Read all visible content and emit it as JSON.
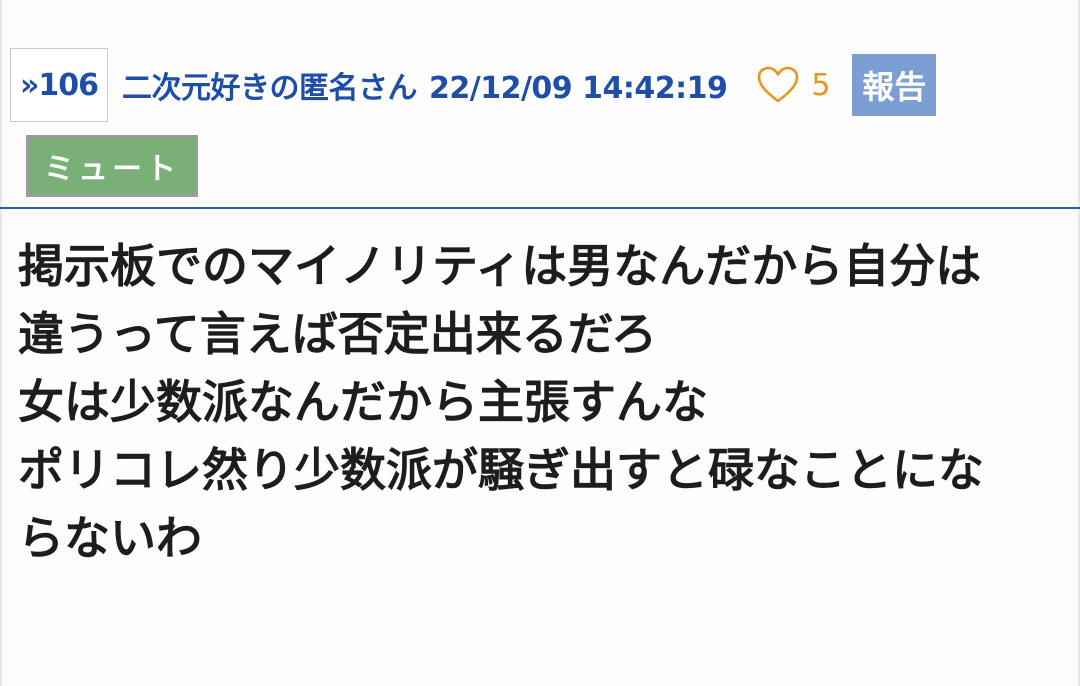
{
  "post": {
    "anchor_label": "»106",
    "author": "二次元好きの匿名さん",
    "datetime": "22/12/09 14:42:19",
    "likes": "5",
    "report_label": "報告",
    "mute_label": "ミュート",
    "body_lines": [
      "掲示板でのマイノリティは男なんだから自分は",
      "違うって言えば否定出来るだろ",
      "女は少数派なんだから主張すんな",
      "ポリコレ然り少数派が騒ぎ出すと碌なことにな",
      "らないわ"
    ]
  },
  "icons": {
    "like": "heart-outline-icon"
  },
  "colors": {
    "link_blue": "#1f4ea8",
    "like_orange": "#e8941f",
    "report_bg": "#7c9fd3",
    "mute_bg": "#79b077",
    "divider": "#2f5aa7"
  }
}
